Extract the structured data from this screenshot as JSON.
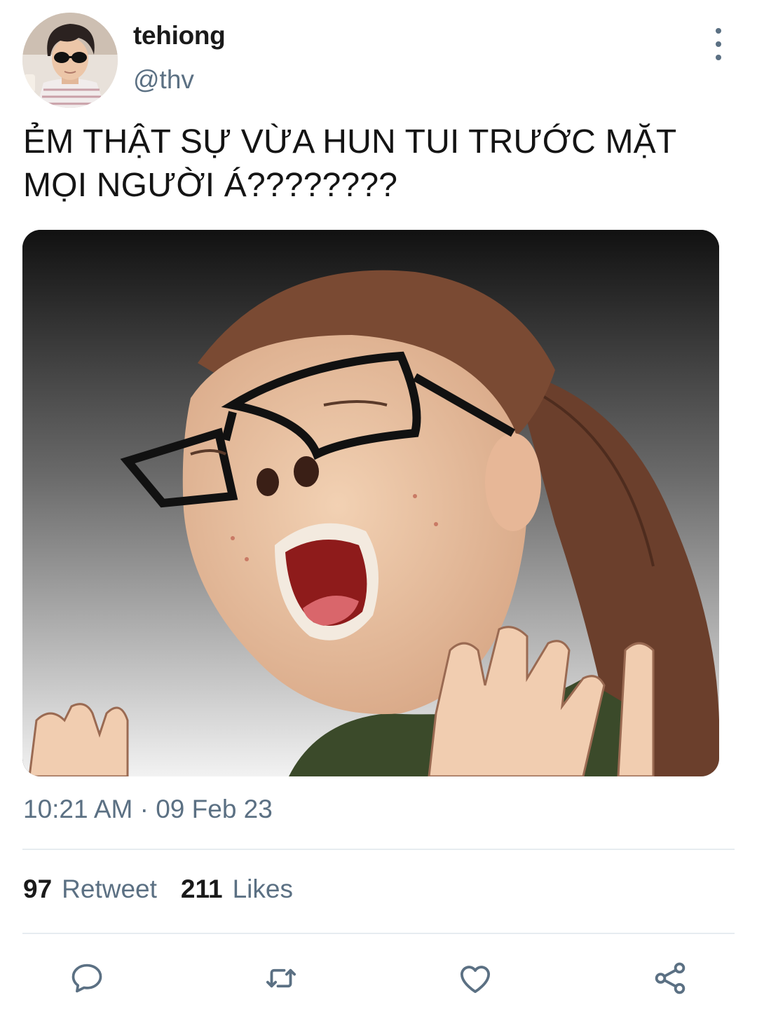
{
  "tweet": {
    "display_name": "tehiong",
    "handle": "@thv",
    "text": "ẺM THẬT SỰ VỪA HUN TUI TRƯỚC MẶT MỌI NGƯỜI Á????????",
    "timestamp": "10:21 AM · 09 Feb 23"
  },
  "stats": {
    "retweets_count": "97",
    "retweets_label": "Retweet",
    "likes_count": "211",
    "likes_label": "Likes"
  },
  "actions": {
    "reply_icon": "reply-icon",
    "retweet_icon": "retweet-icon",
    "like_icon": "heart-icon",
    "share_icon": "share-icon"
  },
  "colors": {
    "secondary_text": "#5b7083",
    "primary_text": "#0f1419",
    "divider": "#e6ecf0"
  }
}
